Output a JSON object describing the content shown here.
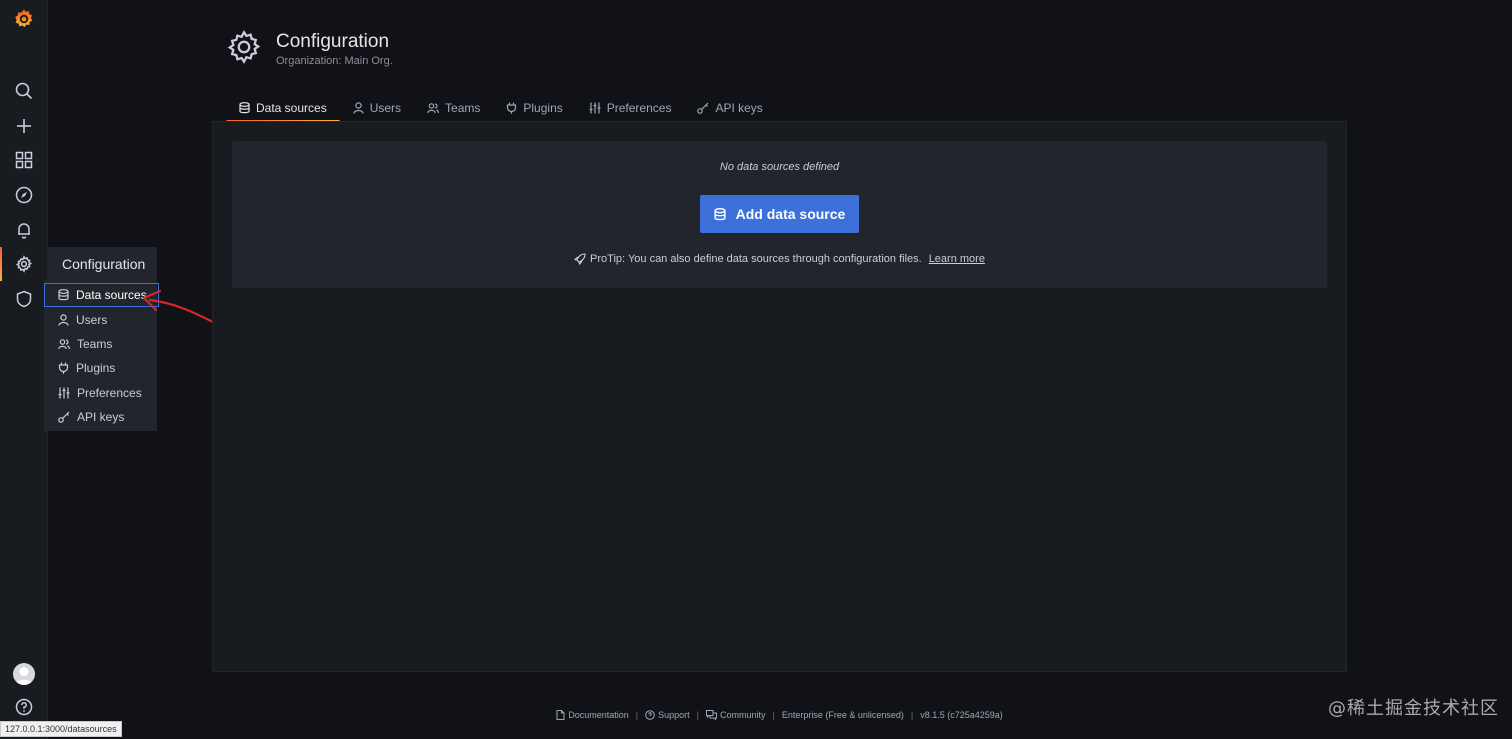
{
  "sidebar": {
    "icons": [
      "grafana-logo",
      "search-icon",
      "plus-icon",
      "dashboards-icon",
      "explore-icon",
      "alerting-icon",
      "gear-icon",
      "shield-icon",
      "avatar",
      "help-icon"
    ],
    "active": "gear-icon"
  },
  "flyout": {
    "header": "Configuration",
    "items": [
      {
        "label": "Data sources",
        "icon": "database-icon"
      },
      {
        "label": "Users",
        "icon": "user-icon"
      },
      {
        "label": "Teams",
        "icon": "users-icon"
      },
      {
        "label": "Plugins",
        "icon": "plug-icon"
      },
      {
        "label": "Preferences",
        "icon": "sliders-icon"
      },
      {
        "label": "API keys",
        "icon": "key-icon"
      }
    ]
  },
  "page": {
    "title": "Configuration",
    "subtitle": "Organization: Main Org."
  },
  "tabs": [
    {
      "label": "Data sources",
      "icon": "database-icon",
      "active": true
    },
    {
      "label": "Users",
      "icon": "user-icon"
    },
    {
      "label": "Teams",
      "icon": "users-icon"
    },
    {
      "label": "Plugins",
      "icon": "plug-icon"
    },
    {
      "label": "Preferences",
      "icon": "sliders-icon"
    },
    {
      "label": "API keys",
      "icon": "key-icon"
    }
  ],
  "empty_state": {
    "message": "No data sources defined",
    "button": "Add data source",
    "protip": "ProTip: You can also define data sources through configuration files.",
    "learn_more": "Learn more"
  },
  "footer": {
    "documentation": "Documentation",
    "support": "Support",
    "community": "Community",
    "edition": "Enterprise (Free & unlicensed)",
    "version": "v8.1.5 (c725a4259a)",
    "separator": "|"
  },
  "status_url": "127.0.0.1:3000/datasources",
  "watermark": "@稀土掘金技术社区",
  "colors": {
    "primary": "#3d71d9",
    "accent_start": "#f55f3e",
    "accent_end": "#f7b336",
    "annotation": "#d7262b"
  }
}
